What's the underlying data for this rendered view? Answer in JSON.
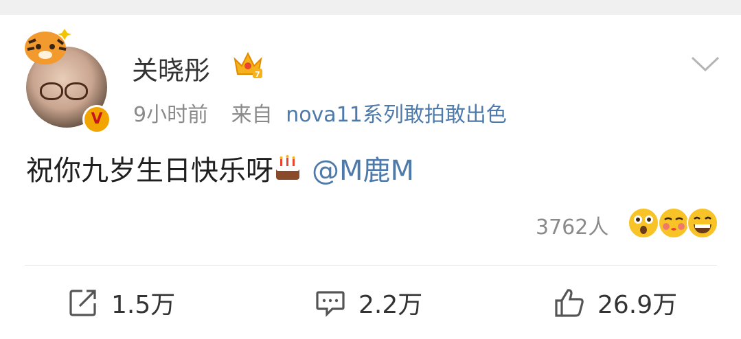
{
  "post": {
    "author": "关晓彤",
    "time": "9小时前",
    "from_label": "来自",
    "source": "nova11系列敢拍敢出色",
    "text": "祝你九岁生日快乐呀",
    "mention": "@M鹿M",
    "reactions_count": "3762人"
  },
  "actions": {
    "repost": "1.5万",
    "comment": "2.2万",
    "like": "26.9万"
  },
  "colors": {
    "link": "#4d7aaa",
    "meta": "#8a8a8a",
    "verified_badge": "#f2a400"
  },
  "icons": [
    "crown-icon",
    "chevron-down-icon",
    "cake-icon",
    "surprised-emoji-icon",
    "kiss-emoji-icon",
    "grin-emoji-icon",
    "repost-icon",
    "comment-icon",
    "like-icon"
  ]
}
